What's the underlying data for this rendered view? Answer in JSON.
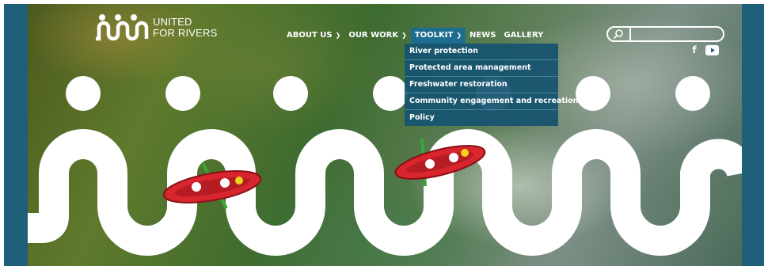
{
  "brand": {
    "logo_text": "UNITED\nFOR RIVERS"
  },
  "nav": {
    "items": [
      {
        "label": "ABOUT US",
        "has_dropdown": true,
        "active": false
      },
      {
        "label": "OUR WORK",
        "has_dropdown": true,
        "active": false
      },
      {
        "label": "TOOLKIT",
        "has_dropdown": true,
        "active": true
      },
      {
        "label": "NEWS",
        "has_dropdown": false,
        "active": false
      },
      {
        "label": "GALLERY",
        "has_dropdown": false,
        "active": false
      }
    ]
  },
  "toolkit_menu": {
    "items": [
      {
        "label": "River protection"
      },
      {
        "label": "Protected area management"
      },
      {
        "label": "Freshwater restoration"
      },
      {
        "label": "Community engagement and recreation"
      },
      {
        "label": "Policy"
      }
    ]
  },
  "search": {
    "icon": "search-icon",
    "value": "",
    "placeholder": ""
  },
  "social": {
    "facebook_glyph": "f",
    "icons": [
      "facebook-icon",
      "youtube-icon"
    ]
  },
  "colors": {
    "frame": "#1f5f79",
    "nav_active": "#1d6d8e",
    "dropdown": "#165470",
    "kayak": "#d8262e",
    "wave": "#ffffff"
  }
}
